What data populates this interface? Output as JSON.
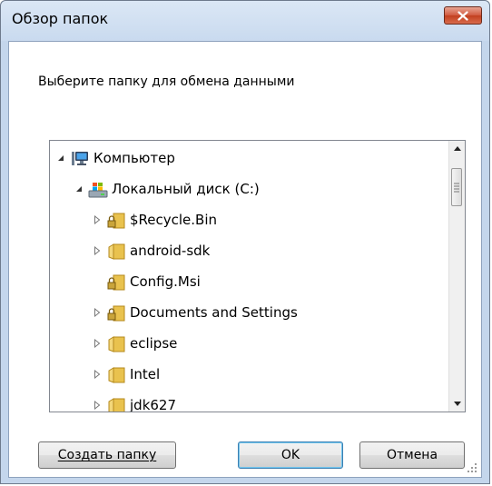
{
  "window": {
    "title": "Обзор папок",
    "prompt": "Выберите папку для обмена данными"
  },
  "tree": {
    "items": [
      {
        "label": "Компьютер",
        "icon": "computer-icon",
        "expander": "expanded"
      },
      {
        "label": "Локальный диск (C:)",
        "icon": "drive-icon",
        "expander": "expanded"
      },
      {
        "label": "$Recycle.Bin",
        "icon": "locked-folder-icon",
        "expander": "collapsed"
      },
      {
        "label": "android-sdk",
        "icon": "folder-icon",
        "expander": "collapsed"
      },
      {
        "label": "Config.Msi",
        "icon": "locked-folder-icon",
        "expander": "none"
      },
      {
        "label": "Documents and Settings",
        "icon": "locked-folder-icon",
        "expander": "collapsed"
      },
      {
        "label": "eclipse",
        "icon": "folder-icon",
        "expander": "collapsed"
      },
      {
        "label": "Intel",
        "icon": "folder-icon",
        "expander": "collapsed"
      },
      {
        "label": "jdk627",
        "icon": "folder-icon",
        "expander": "collapsed"
      }
    ]
  },
  "buttons": {
    "new_folder": "Создать папку",
    "ok": "OK",
    "cancel": "Отмена"
  },
  "colors": {
    "frame": "#c4d6ec",
    "close": "#c7442a",
    "folder": "#e7c04b",
    "default_button_border": "#3c7fb1"
  }
}
